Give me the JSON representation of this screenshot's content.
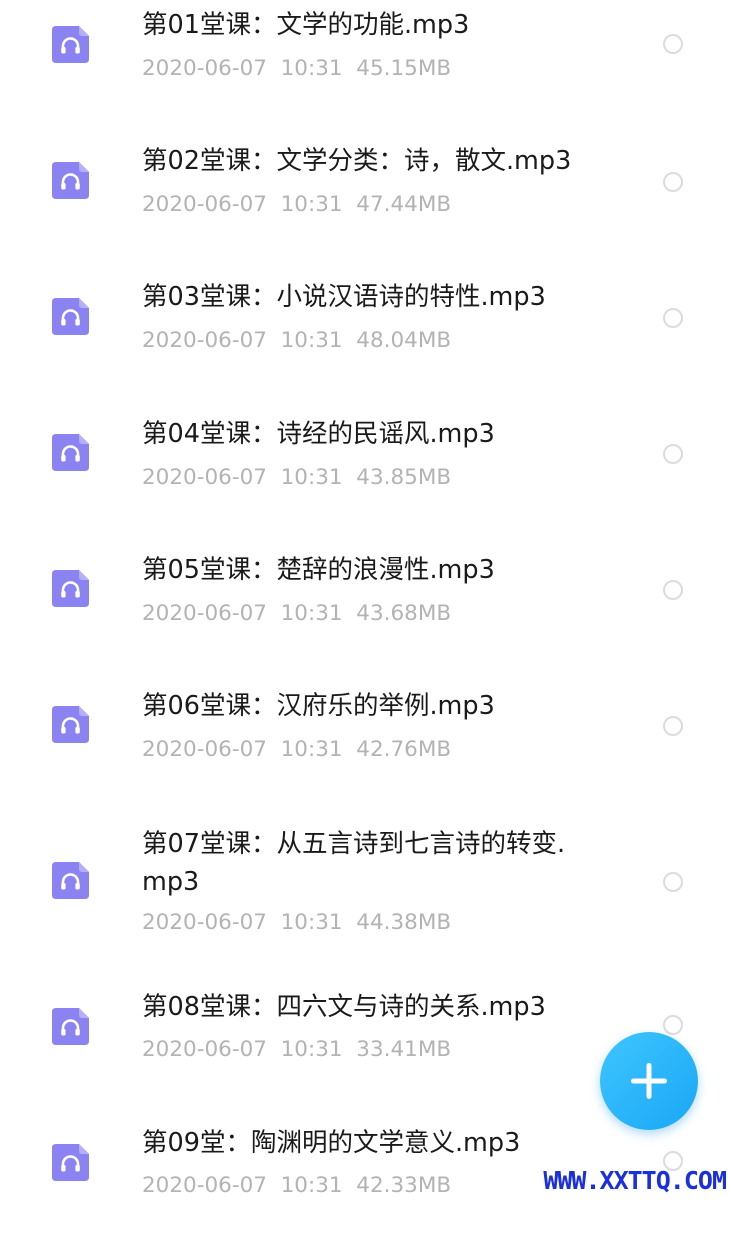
{
  "files": [
    {
      "name": "第01堂课：文学的功能.mp3",
      "date": "2020-06-07",
      "time": "10:31",
      "size": "45.15MB"
    },
    {
      "name": "第02堂课：文学分类：诗，散文.mp3",
      "date": "2020-06-07",
      "time": "10:31",
      "size": "47.44MB"
    },
    {
      "name": "第03堂课：小说汉语诗的特性.mp3",
      "date": "2020-06-07",
      "time": "10:31",
      "size": "48.04MB"
    },
    {
      "name": "第04堂课：诗经的民谣风.mp3",
      "date": "2020-06-07",
      "time": "10:31",
      "size": "43.85MB"
    },
    {
      "name": "第05堂课：楚辞的浪漫性.mp3",
      "date": "2020-06-07",
      "time": "10:31",
      "size": "43.68MB"
    },
    {
      "name": "第06堂课：汉府乐的举例.mp3",
      "date": "2020-06-07",
      "time": "10:31",
      "size": "42.76MB"
    },
    {
      "name": "第07堂课：从五言诗到七言诗的转变.mp3",
      "date": "2020-06-07",
      "time": "10:31",
      "size": "44.38MB"
    },
    {
      "name": "第08堂课：四六文与诗的关系.mp3",
      "date": "2020-06-07",
      "time": "10:31",
      "size": "33.41MB"
    },
    {
      "name": "第09堂：陶渊明的文学意义.mp3",
      "date": "2020-06-07",
      "time": "10:31",
      "size": "42.33MB"
    }
  ],
  "icons": {
    "file": "audio-file-icon",
    "fab": "plus-icon"
  },
  "colors": {
    "file_icon": "#8b83f2",
    "file_icon_fold": "#b5aef8",
    "accent": "#1aa7f5",
    "meta_text": "#b3b3b3",
    "watermark": "#1a2fdd"
  },
  "watermark": "WWW.XXTTQ.COM"
}
